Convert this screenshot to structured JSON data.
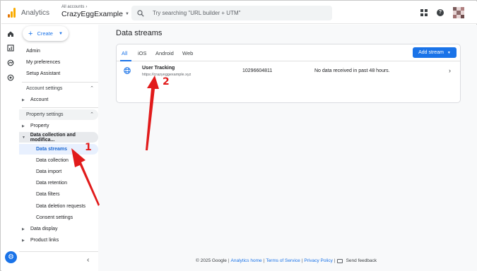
{
  "header": {
    "app_title": "Analytics",
    "breadcrumb": "All accounts",
    "account_name": "CrazyEggExample",
    "search_placeholder": "Try searching \"URL builder + UTM\"",
    "logo_colors": [
      "#f9ab00",
      "#e37400"
    ],
    "avatar_colors": [
      "#7a5a5a",
      "#e6d4d4",
      "#b08080",
      "#e6d4d4",
      "#8c6a6a",
      "#e6d4d4",
      "#a07070",
      "#e6d4d4",
      "#6e4c4c"
    ]
  },
  "rail": {
    "icons": [
      "home-icon",
      "reports-icon",
      "explore-icon",
      "advertising-icon"
    ],
    "settings_icon": "gear-icon"
  },
  "side_nav": {
    "create_label": "Create",
    "admin": "Admin",
    "preferences": "My preferences",
    "setup_assistant": "Setup Assistant",
    "account_settings": "Account settings",
    "account": "Account",
    "property_settings": "Property settings",
    "property": "Property",
    "data_collection": "Data collection and modifica...",
    "data_streams": "Data streams",
    "data_collection_sub": "Data collection",
    "data_import": "Data import",
    "data_retention": "Data retention",
    "data_filters": "Data filters",
    "data_deletion": "Data deletion requests",
    "consent_settings": "Consent settings",
    "data_display": "Data display",
    "product_links": "Product links"
  },
  "main": {
    "title": "Data streams",
    "tabs": [
      "All",
      "iOS",
      "Android",
      "Web"
    ],
    "active_tab": "All",
    "add_stream_label": "Add stream",
    "streams": [
      {
        "name": "User Tracking",
        "url": "https://crazyeggexample.xyz",
        "id": "10296604811",
        "status": "No data received in past 48 hours."
      }
    ]
  },
  "footer": {
    "copyright": "© 2025 Google",
    "links": [
      "Analytics home",
      "Terms of Service",
      "Privacy Policy"
    ],
    "feedback": "Send feedback"
  },
  "annotations": {
    "label_1": "1",
    "label_2": "2",
    "color": "#e11b1b"
  },
  "colors": {
    "accent": "#1a73e8",
    "selected_bg": "#e8f0fe"
  }
}
